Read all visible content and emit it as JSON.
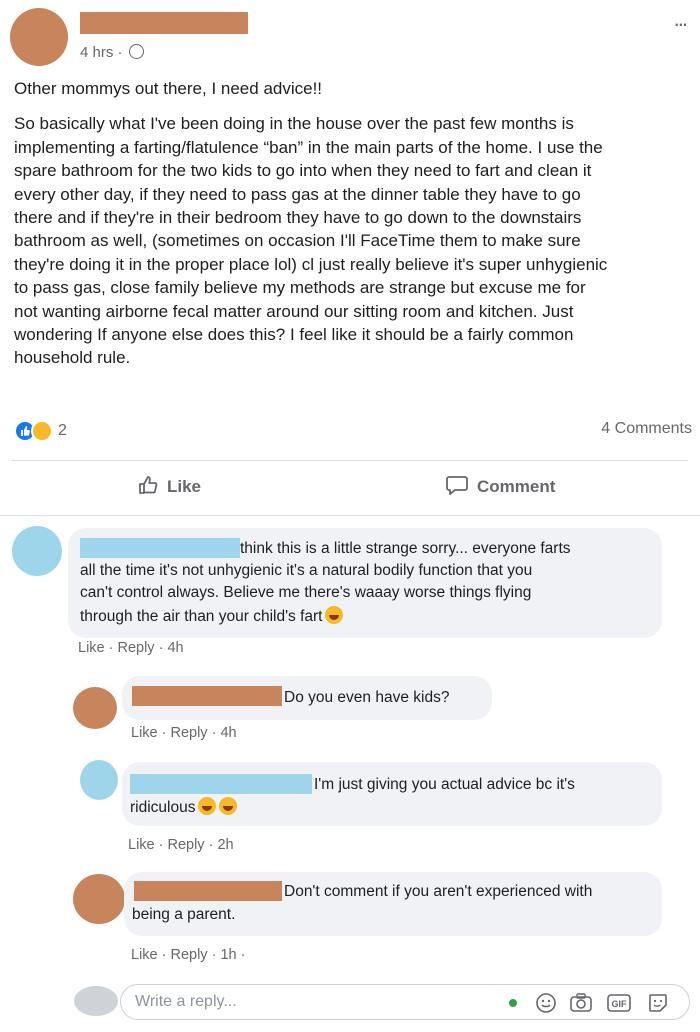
{
  "post": {
    "time": "4 hrs ·",
    "more_label": "...",
    "title": "Other mommys out there, I need advice!!",
    "body_lines": [
      "So basically what I've been doing in the house over the past few months is",
      "implementing a farting/flatulence “ban” in the main parts of the home. I use the",
      "spare bathroom for the two kids to go into when they need to fart and clean it",
      "every other day, if they need to pass gas at the dinner table they have to go",
      "there and if they're in their bedroom they have to go down to the downstairs",
      "bathroom as well, (sometimes on occasion I'll FaceTime them to make sure",
      "they're doing it in the proper place lol) cl just really believe it's super unhygienic",
      "to pass gas, close family believe my methods are strange but excuse me for",
      "not wanting airborne fecal matter around our sitting room and kitchen. Just",
      "wondering If anyone else does this? I feel like it should be a fairly common",
      "household rule."
    ],
    "reaction_count": "2",
    "comments_count": "4 Comments",
    "like_label": "Like",
    "comment_label": "Comment"
  },
  "comments": [
    {
      "lines": [
        "think this is a little strange sorry... everyone farts",
        "all the time it's not unhygienic it's a natural bodily function that you",
        "can't control always. Believe me there's waaay worse things flying",
        "through the air than your child's fart"
      ],
      "meta": "Like · Reply · 4h"
    },
    {
      "lines": [
        "Do you even have kids?"
      ],
      "meta": "Like · Reply · 4h"
    },
    {
      "lines": [
        "I'm just giving you actual advice bc it's",
        "ridiculous"
      ],
      "meta": "Like · Reply · 2h"
    },
    {
      "lines": [
        "Don't comment if you aren't experienced with",
        "being a parent."
      ],
      "meta": "Like · Reply · 1h ·"
    }
  ],
  "reply_input": {
    "placeholder": "Write a reply..."
  },
  "colors": {
    "redact_brown": "#c8845a",
    "redact_blue": "#9fd5ea",
    "avatar_brown": "#c8845a",
    "avatar_blue": "#9fd5ea",
    "fb_blue": "#1877f2"
  },
  "icons": [
    "globe-icon",
    "like-icon",
    "comment-icon",
    "emoji-icon",
    "camera-icon",
    "gif-icon",
    "sticker-icon"
  ]
}
